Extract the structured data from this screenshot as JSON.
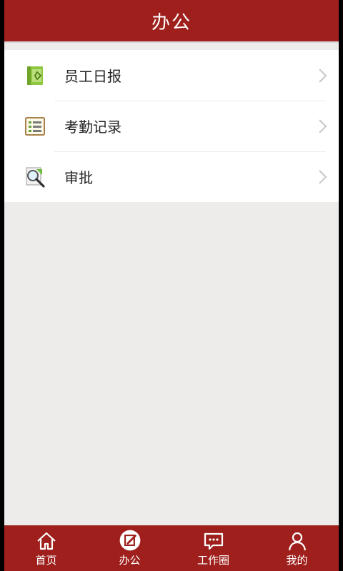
{
  "header": {
    "title": "办公"
  },
  "menu": {
    "items": [
      {
        "label": "员工日报",
        "icon": "notebook-icon"
      },
      {
        "label": "考勤记录",
        "icon": "checklist-icon"
      },
      {
        "label": "审批",
        "icon": "magnifier-doc-icon"
      }
    ]
  },
  "tabs": [
    {
      "label": "首页",
      "icon": "home-icon"
    },
    {
      "label": "办公",
      "icon": "edit-icon",
      "active": true
    },
    {
      "label": "工作圈",
      "icon": "chat-icon"
    },
    {
      "label": "我的",
      "icon": "person-icon"
    }
  ],
  "colors": {
    "brand": "#9e1f1c",
    "background": "#edecea",
    "icon_green": "#8fc63f",
    "icon_brown": "#a8804c"
  }
}
